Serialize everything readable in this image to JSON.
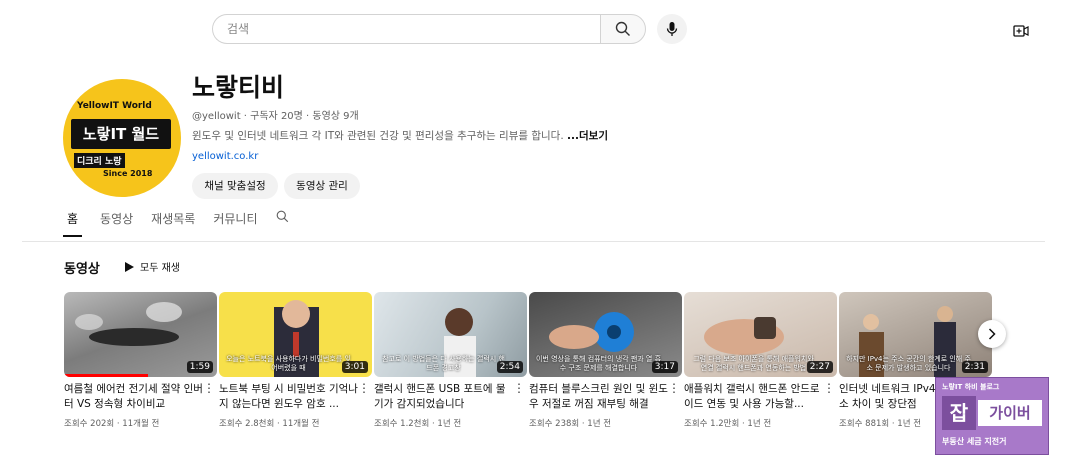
{
  "search": {
    "placeholder": "검색"
  },
  "channel": {
    "name": "노랗티비",
    "meta": "@yellowit · 구독자 20명 · 동영상 9개",
    "description": "윈도우 및 인터넷 네트워크 각 IT와 관련된 건강 및 편리성을 추구하는 리뷰를 합니다. ",
    "more": "...더보기",
    "link": "yellowit.co.kr",
    "buttons": {
      "customize": "채널 맞춤설정",
      "manage": "동영상 관리"
    },
    "avatar": {
      "line1": "YellowIT World",
      "line2": "노랗IT 월드",
      "line3": "디크리 노랑",
      "line4": "Since 2018"
    }
  },
  "tabs": [
    "홈",
    "동영상",
    "재생목록",
    "커뮤니티"
  ],
  "section": {
    "title": "동영상",
    "play_all": "모두 재생"
  },
  "videos": [
    {
      "title": "여름철 에어컨 전기세 절약 인버터 VS 정속형 차이비교",
      "meta": "조회수 202회 · 11개월 전",
      "duration": "1:59",
      "caption": "",
      "progress": 0.55
    },
    {
      "title": "노트북 부팅 시 비밀번호 기억나지 않는다면 윈도우 암호 ...",
      "meta": "조회수 2.8천회 · 11개월 전",
      "duration": "3:01",
      "caption": "오늘은 노트북을 사용하다가 비밀번호를 잊어버렸을 때",
      "progress": 0
    },
    {
      "title": "갤럭시 핸드폰 USB 포트에 물기가 감지되었습니다",
      "meta": "조회수 1.2천회 · 1년 전",
      "duration": "2:54",
      "caption": "참고로 이 방법들은 다 사용하는 갤럭시 핸드폰 경고창",
      "progress": 0
    },
    {
      "title": "컴퓨터 블루스크린 원인 및 윈도우 저절로 꺼짐 재부팅 해결",
      "meta": "조회수 238회 · 1년 전",
      "duration": "3:17",
      "caption": "이번 영상을 통해 컴퓨터의 냉각 팬과 열 흡수 구조 문제를 해결합니다",
      "progress": 0
    },
    {
      "title": "애플워치 갤럭시 핸드폰 안드로이드 연동 및 사용 가능할...",
      "meta": "조회수 1.2만회 · 1년 전",
      "duration": "2:27",
      "caption": "그럼 다음 보조 아이폰을 통해 애플워치와 연결 갤럭시 핸드폰과 연동하는 방법",
      "progress": 0
    },
    {
      "title": "인터넷 네트워크 IPv4 IPv6 주소 차이 및 장단점",
      "meta": "조회수 881회 · 1년 전",
      "duration": "2:31",
      "caption": "하지만 IPv4는 주소 공간의 한계로 인해 주소 문제가 발생하고 있습니다",
      "progress": 0
    }
  ],
  "watermark": {
    "top": "노랗IT 하비 블로그",
    "big1": "잡",
    "big2": "가이버",
    "bottom": "부동산 세금 지전거"
  },
  "colors": {
    "accent": "#065fd4",
    "avatar_bg": "#f6c41b",
    "progress": "#ff0000",
    "watermark": "#a879c9"
  }
}
